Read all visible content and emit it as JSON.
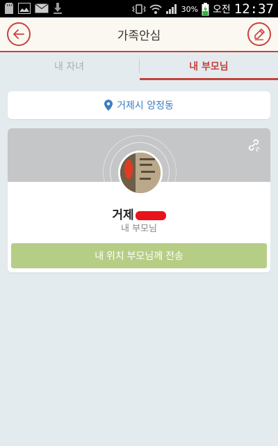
{
  "status_bar": {
    "icons": [
      "sd-card-icon",
      "image-icon",
      "mail-icon",
      "download-icon",
      "vibrate-icon",
      "wifi-icon",
      "signal-icon",
      "battery-charging-icon"
    ],
    "battery_percent": "30%",
    "clock_ampm": "오전",
    "clock_time": "12:37"
  },
  "header": {
    "title": "가족안심",
    "back_icon": "arrow-left-icon",
    "edit_icon": "pencil-icon"
  },
  "tabs": [
    {
      "label": "내 자녀",
      "active": false
    },
    {
      "label": "내 부모님",
      "active": true
    }
  ],
  "location": {
    "icon": "map-pin-icon",
    "text": "거제시 양정동"
  },
  "profile": {
    "name_visible": "거제",
    "relation": "내 부모님",
    "link_icon": "link-icon",
    "send_button_label": "내 위치 부모님께 전송"
  },
  "colors": {
    "accent": "#c8413b",
    "background": "#e4ebee",
    "location_text": "#3c7ec1",
    "send_button": "#b6cd85",
    "banner": "#c5c6c7"
  }
}
